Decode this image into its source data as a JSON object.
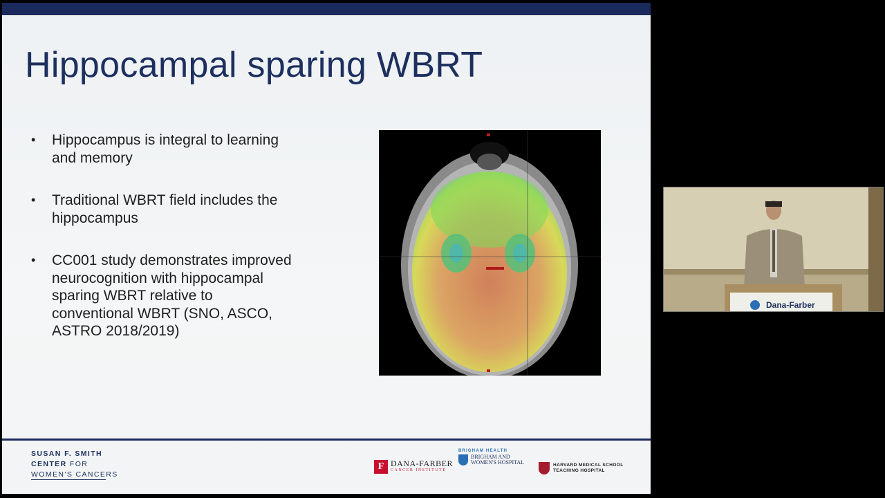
{
  "slide": {
    "title": "Hippocampal sparing WBRT",
    "bullets": [
      "Hippocampus is integral to learning and memory",
      "Traditional WBRT field includes the hippocampus",
      "CC001 study demonstrates improved neurocognition with hippocampal sparing WBRT relative to conventional WBRT (SNO, ASCO, ASTRO 2018/2019)"
    ],
    "footer": {
      "center_line1": "SUSAN F. SMITH",
      "center_line2_bold": "CENTER",
      "center_line2_thin": "FOR",
      "center_line3": "WOMEN'S CANCERS",
      "df_name": "DANA-FARBER",
      "df_sub": "CANCER INSTITUTE",
      "bwh_top": "BRIGHAM HEALTH",
      "bwh_name_1": "BRIGHAM AND",
      "bwh_name_2": "WOMEN'S HOSPITAL",
      "hms_line1": "HARVARD MEDICAL SCHOOL",
      "hms_line2": "TEACHING HOSPITAL"
    },
    "colors": {
      "navy": "#1b2a5c",
      "df_red": "#c8102e",
      "bwh_blue": "#2a6fb5",
      "hms_crimson": "#a51c30"
    }
  },
  "speaker_video": {
    "lectern_label": "Dana-Farber"
  }
}
